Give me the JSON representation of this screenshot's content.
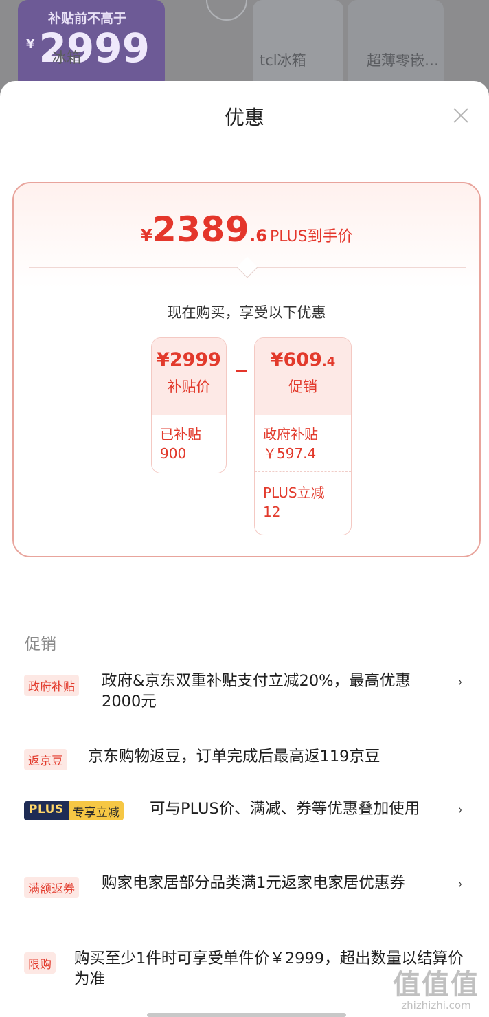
{
  "background": {
    "card_subtitle": "补贴前不高于",
    "card_price": "2999",
    "card_currency": "¥",
    "label_left": "冰箱",
    "label_mid": "tcl冰箱",
    "label_right": "超薄零嵌…"
  },
  "sheet": {
    "title": "优惠",
    "close_icon": "close-icon"
  },
  "summary": {
    "currency": "¥",
    "price_int": "2389",
    "price_dec": ".6",
    "price_tag": "PLUS到手价",
    "subhead": "现在购买，享受以下优惠",
    "box_left": {
      "amount": "¥2999",
      "label": "补贴价",
      "line1": "已补贴",
      "line2": "900"
    },
    "box_right": {
      "amount_int": "¥609",
      "amount_dec": ".4",
      "label": "促销",
      "item1_line1": "政府补贴",
      "item1_line2": "￥597.4",
      "item2_line1": "PLUS立减",
      "item2_line2": "12"
    }
  },
  "promotions": {
    "section_label": "促销",
    "items": [
      {
        "badge": "政府补贴",
        "text": "政府&京东双重补贴支付立减20%，最高优惠2000元",
        "has_arrow": true
      },
      {
        "badge": "返京豆",
        "text": "京东购物返豆，订单完成后最高返119京豆",
        "has_arrow": false
      },
      {
        "badge_plus": "PLUS",
        "badge_extra": "专享立减",
        "text": "可与PLUS价、满减、券等优惠叠加使用",
        "has_arrow": true
      },
      {
        "badge": "满额返券",
        "text": "购家电家居部分品类满1元返家电家居优惠券",
        "has_arrow": true
      },
      {
        "badge": "限购",
        "text": "购买至少1件时可享受单件价￥2999，超出数量以结算价为准",
        "has_arrow": false
      }
    ],
    "arrow_glyph": "›"
  },
  "watermark": {
    "big": "值值值",
    "small": "zhizhizhi.com"
  },
  "colors": {
    "accent": "#e4362b",
    "badge_bg": "#fde8e4",
    "plus_dark": "#1e2c55",
    "plus_gold": "#f6c744"
  }
}
